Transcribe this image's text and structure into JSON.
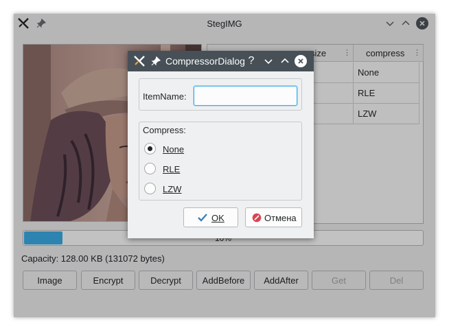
{
  "main_window": {
    "title": "StegIMG",
    "table": {
      "columns": [
        "size",
        "compress"
      ],
      "rows": [
        {
          "compress": "None"
        },
        {
          "compress": "RLE"
        },
        {
          "compress": "LZW"
        }
      ]
    },
    "progress": {
      "value_percent": 10,
      "label": "10%"
    },
    "capacity_text": "Capacity: 128.00 KB (131072 bytes)",
    "buttons": [
      {
        "label": "Image",
        "enabled": true
      },
      {
        "label": "Encrypt",
        "enabled": true
      },
      {
        "label": "Decrypt",
        "enabled": true
      },
      {
        "label": "AddBefore",
        "enabled": true
      },
      {
        "label": "AddAfter",
        "enabled": true
      },
      {
        "label": "Get",
        "enabled": false
      },
      {
        "label": "Del",
        "enabled": false
      }
    ]
  },
  "dialog": {
    "title": "CompressorDialog",
    "help_glyph": "?",
    "item_name_label": "ItemName:",
    "item_name_value": "",
    "compress_label": "Compress:",
    "options": [
      {
        "label": "None",
        "checked": true
      },
      {
        "label": "RLE",
        "checked": false
      },
      {
        "label": "LZW",
        "checked": false
      }
    ],
    "ok_label": "OK",
    "cancel_label": "Отмена"
  },
  "colors": {
    "accent": "#3daee9",
    "window_bg": "#eff0f1",
    "dialog_titlebar": "#475057",
    "cancel_icon": "#da4453"
  },
  "icons": [
    "app-icon",
    "pin-icon",
    "minimize-icon",
    "maximize-icon",
    "close-icon",
    "help-icon",
    "ok-check-icon",
    "cancel-icon"
  ]
}
